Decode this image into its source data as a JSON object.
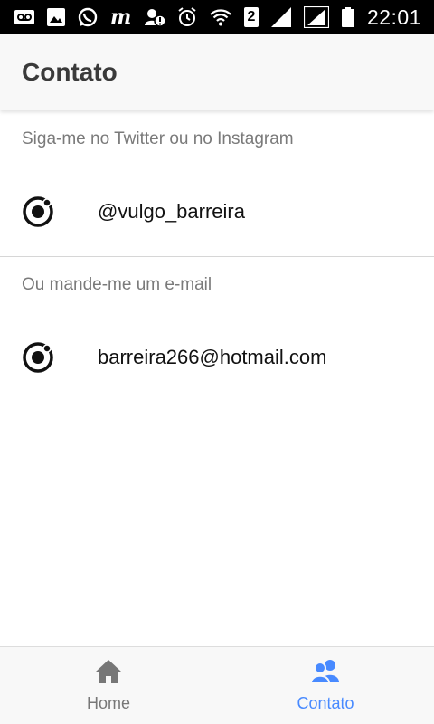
{
  "status_bar": {
    "badge": "2",
    "time": "22:01",
    "left_icons": [
      "voicemail-icon",
      "image-icon",
      "whatsapp-icon",
      "m-app-icon",
      "account-alert-icon"
    ],
    "right_icons": [
      "alarm-icon",
      "wifi-icon",
      "sim-badge",
      "signal-icon",
      "signal-icon",
      "battery-icon"
    ],
    "m_glyph": "m"
  },
  "header": {
    "title": "Contato"
  },
  "sections": [
    {
      "label": "Siga-me no Twitter ou no Instagram",
      "item_text": "@vulgo_barreira",
      "icon": "ionic-icon"
    },
    {
      "label": "Ou mande-me um e-mail",
      "item_text": "barreira266@hotmail.com",
      "icon": "ionic-icon"
    }
  ],
  "tabs": [
    {
      "label": "Home",
      "icon": "home-icon",
      "active": false
    },
    {
      "label": "Contato",
      "icon": "contacts-icon",
      "active": true
    }
  ],
  "colors": {
    "accent": "#488aff",
    "inactive": "#777777",
    "header_bg": "#f8f8f8"
  }
}
